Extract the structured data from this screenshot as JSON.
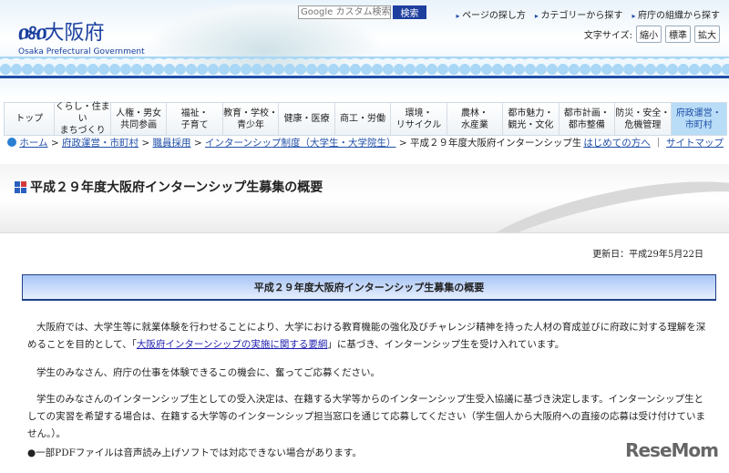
{
  "header": {
    "logo_jp": "大阪府",
    "logo_en": "Osaka Prefectural Government",
    "search_placeholder": "Google カスタム検索",
    "search_button": "検索",
    "links": [
      "ページの探し方",
      "カテゴリーから探す",
      "府庁の組織から探す"
    ],
    "font_size_label": "文字サイズ:",
    "font_sizes": [
      "縮小",
      "標準",
      "拡大"
    ]
  },
  "nav": [
    "トップ",
    "くらし・住まい\nまちづくり",
    "人権・男女\n共同参画",
    "福祉・\n子育て",
    "教育・学校・\n青少年",
    "健康・医療",
    "商工・労働",
    "環境・\nリサイクル",
    "農林・\n水産業",
    "都市魅力・\n観光・文化",
    "都市計画・\n都市整備",
    "防災・安全・\n危機管理",
    "府政運営・\n市町村"
  ],
  "breadcrumb": {
    "items": [
      "ホーム",
      "府政運営・市町村",
      "職員採用",
      "インターンシップ制度（大学生・大学院生）"
    ],
    "current": "平成２９年度大阪府インターンシップ生募集の概要",
    "first_visit": "はじめての方へ",
    "sitemap": "サイトマップ"
  },
  "page_title": "平成２９年度大阪府インターンシップ生募集の概要",
  "updated": "更新日：平成29年5月22日",
  "section_title": "平成２９年度大阪府インターンシップ生募集の概要",
  "para1_a": "大阪府では、大学生等に就業体験を行わせることにより、大学における教育機能の強化及びチャレンジ精神を持った人材の育成並びに府政に対する理解を深めることを目的として、「",
  "para1_link": "大阪府インターンシップの実施に関する要綱",
  "para1_b": "」に基づき、インターンシップ生を受け入れています。",
  "para2": "学生のみなさん、府庁の仕事を体験できるこの機会に、奮ってご応募ください。",
  "para3": "学生のみなさんのインターンシップ生としての受入決定は、在籍する大学等からのインターンシップ生受入協議に基づき決定します。インターンシップ生としての実習を希望する場合は、在籍する大学等のインターンシップ担当窓口を通じて応募してください（学生個人から大阪府への直接の応募は受け付けていません。）。",
  "pdf_note": "●一部PDFファイルは音声読み上げソフトでは対応できない場合があります。",
  "watermark": "ReseMom"
}
